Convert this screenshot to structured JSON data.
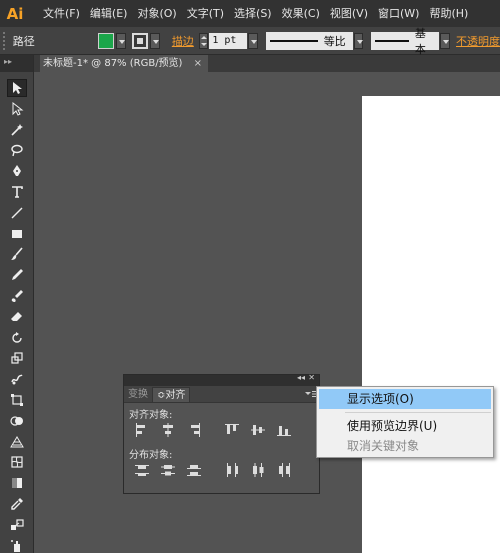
{
  "app": {
    "logo_text": "Ai"
  },
  "menubar": {
    "items": [
      "文件(F)",
      "编辑(E)",
      "对象(O)",
      "文字(T)",
      "选择(S)",
      "效果(C)",
      "视图(V)",
      "窗口(W)",
      "帮助(H)"
    ]
  },
  "controlbar": {
    "selection_label": "路径",
    "fill_color": "#1ba64a",
    "stroke_label": "描边",
    "stroke_weight": "1 pt",
    "profile_label": "等比",
    "brush_label": "基本",
    "opacity_label": "不透明度"
  },
  "document": {
    "tab_title": "未标题-1* @ 87% (RGB/预览)",
    "close_glyph": "×"
  },
  "toolbox": {
    "header": "▸▸",
    "tools": [
      "selection",
      "direct-selection",
      "magic-wand",
      "lasso",
      "pen",
      "type",
      "line-segment",
      "rectangle",
      "paintbrush",
      "pencil",
      "blob-brush",
      "eraser",
      "rotate",
      "scale",
      "warp",
      "free-transform",
      "shape-builder",
      "perspective-grid",
      "mesh",
      "gradient",
      "eyedropper",
      "blend",
      "symbol-sprayer"
    ]
  },
  "align_panel": {
    "tabs": [
      "变换",
      "≎对齐"
    ],
    "active_tab": 1,
    "align_objects_label": "对齐对象:",
    "distribute_objects_label": "分布对象:",
    "collapse_glyph": "◂◂",
    "close_glyph": "✕"
  },
  "panel_menu": {
    "items": [
      {
        "label": "显示选项(O)",
        "highlighted": true,
        "disabled": false
      },
      {
        "label": "使用预览边界(U)",
        "highlighted": false,
        "disabled": false
      },
      {
        "label": "取消关键对象",
        "highlighted": false,
        "disabled": true
      }
    ]
  }
}
